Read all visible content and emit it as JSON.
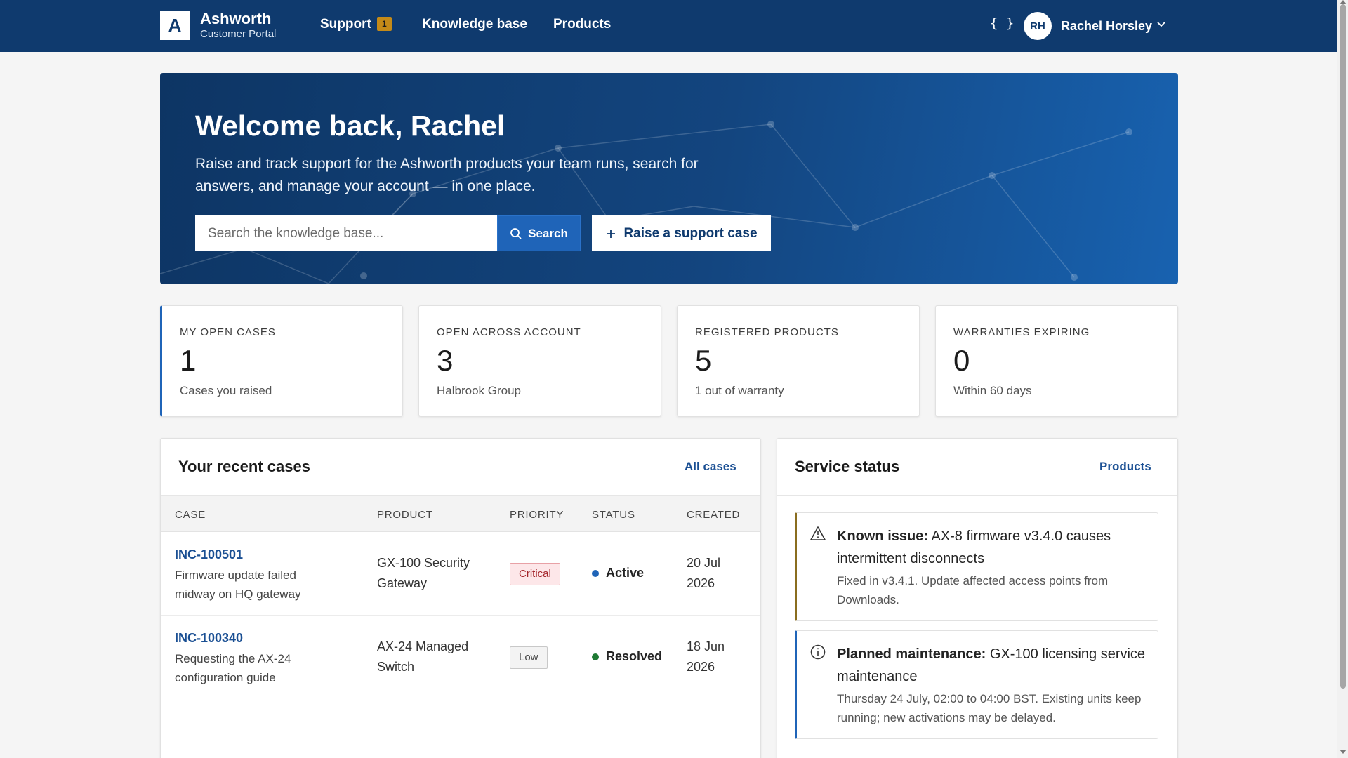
{
  "brand": {
    "logo_letter": "A",
    "name": "Ashworth",
    "subtitle": "Customer Portal"
  },
  "nav": {
    "items": [
      {
        "label": "Support",
        "badge": "1"
      },
      {
        "label": "Knowledge base"
      },
      {
        "label": "Products"
      }
    ],
    "dev_icon": "{ }",
    "user": {
      "initials": "RH",
      "name": "Rachel Horsley"
    }
  },
  "hero": {
    "title": "Welcome back, Rachel",
    "description": "Raise and track support for the Ashworth products your team runs, search for answers, and manage your account — in one place.",
    "search_placeholder": "Search the knowledge base...",
    "search_label": "Search",
    "raise_label": "Raise a support case"
  },
  "stats": [
    {
      "label": "MY OPEN CASES",
      "value": "1",
      "sub": "Cases you raised"
    },
    {
      "label": "OPEN ACROSS ACCOUNT",
      "value": "3",
      "sub": "Halbrook Group"
    },
    {
      "label": "REGISTERED PRODUCTS",
      "value": "5",
      "sub": "1 out of warranty"
    },
    {
      "label": "WARRANTIES EXPIRING",
      "value": "0",
      "sub": "Within 60 days"
    }
  ],
  "recent_cases": {
    "title": "Your recent cases",
    "link": "All cases",
    "columns": [
      "CASE",
      "PRODUCT",
      "PRIORITY",
      "STATUS",
      "CREATED"
    ],
    "rows": [
      {
        "id": "INC-100501",
        "desc": "Firmware update failed midway on HQ gateway",
        "product": "GX-100 Security Gateway",
        "priority": "Critical",
        "status": "Active",
        "created": "20 Jul 2026"
      },
      {
        "id": "INC-100340",
        "desc": "Requesting the AX-24 configuration guide",
        "product": "AX-24 Managed Switch",
        "priority": "Low",
        "status": "Resolved",
        "created": "18 Jun 2026"
      }
    ]
  },
  "service_status": {
    "title": "Service status",
    "link": "Products",
    "notices": [
      {
        "type": "warning",
        "icon": "warning-triangle-icon",
        "label": "Known issue:",
        "title": "AX-8 firmware v3.4.0 causes intermittent disconnects",
        "body": "Fixed in v3.4.1. Update affected access points from Downloads."
      },
      {
        "type": "info",
        "icon": "info-circle-icon",
        "label": "Planned maintenance:",
        "title": "GX-100 licensing service maintenance",
        "body": "Thursday 24 July, 02:00 to 04:00 BST. Existing units keep running; new activations may be delayed."
      }
    ]
  },
  "colors": {
    "nav": "#0f3a6e",
    "accent": "#1f64b8",
    "link": "#1a4f93",
    "active": "#1f64b8",
    "resolved": "#1e7a34",
    "warning": "#8a6d1f",
    "critical": "#a4262c"
  }
}
